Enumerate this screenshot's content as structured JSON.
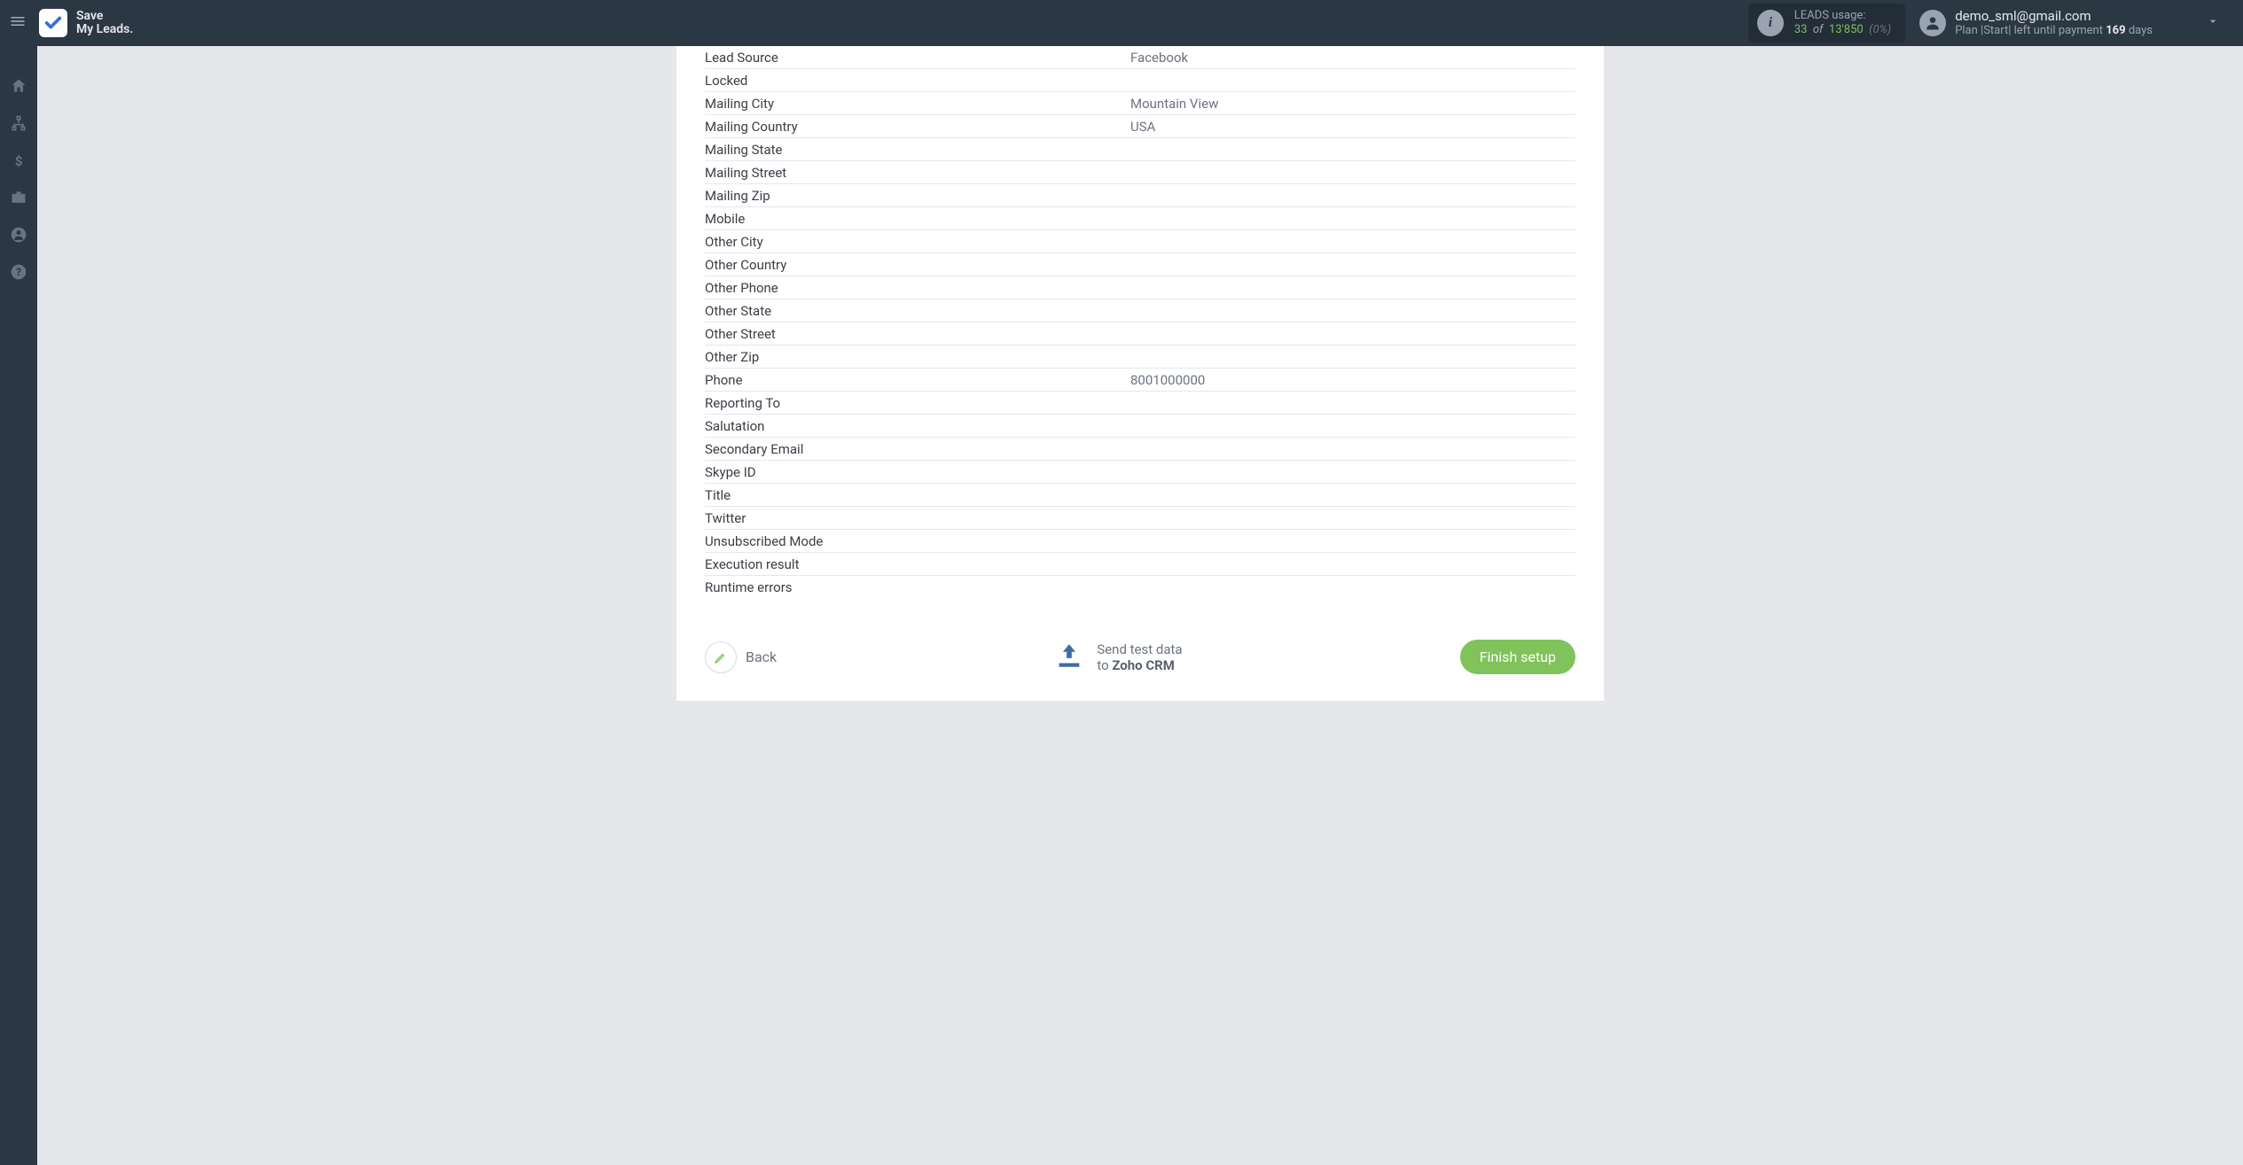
{
  "header": {
    "brand_line1": "Save",
    "brand_line2": "My Leads.",
    "usage_label": "LEADS usage:",
    "usage_used": "33",
    "usage_of": "of",
    "usage_total": "13'850",
    "usage_pct": "(0%)",
    "user_email": "demo_sml@gmail.com",
    "plan_prefix": "Plan |Start| left until payment ",
    "plan_days_value": "169",
    "plan_days_suffix": " days"
  },
  "rows": [
    {
      "label": "Lead Source",
      "value": "Facebook"
    },
    {
      "label": "Locked",
      "value": ""
    },
    {
      "label": "Mailing City",
      "value": "Mountain View"
    },
    {
      "label": "Mailing Country",
      "value": "USA"
    },
    {
      "label": "Mailing State",
      "value": ""
    },
    {
      "label": "Mailing Street",
      "value": ""
    },
    {
      "label": "Mailing Zip",
      "value": ""
    },
    {
      "label": "Mobile",
      "value": ""
    },
    {
      "label": "Other City",
      "value": ""
    },
    {
      "label": "Other Country",
      "value": ""
    },
    {
      "label": "Other Phone",
      "value": ""
    },
    {
      "label": "Other State",
      "value": ""
    },
    {
      "label": "Other Street",
      "value": ""
    },
    {
      "label": "Other Zip",
      "value": ""
    },
    {
      "label": "Phone",
      "value": "8001000000"
    },
    {
      "label": "Reporting To",
      "value": ""
    },
    {
      "label": "Salutation",
      "value": ""
    },
    {
      "label": "Secondary Email",
      "value": ""
    },
    {
      "label": "Skype ID",
      "value": ""
    },
    {
      "label": "Title",
      "value": ""
    },
    {
      "label": "Twitter",
      "value": ""
    },
    {
      "label": "Unsubscribed Mode",
      "value": ""
    },
    {
      "label": "Execution result",
      "value": ""
    },
    {
      "label": "Runtime errors",
      "value": ""
    }
  ],
  "actions": {
    "back": "Back",
    "send_line1": "Send test data",
    "send_line2_prefix": "to ",
    "send_line2_bold": "Zoho CRM",
    "finish": "Finish setup"
  }
}
